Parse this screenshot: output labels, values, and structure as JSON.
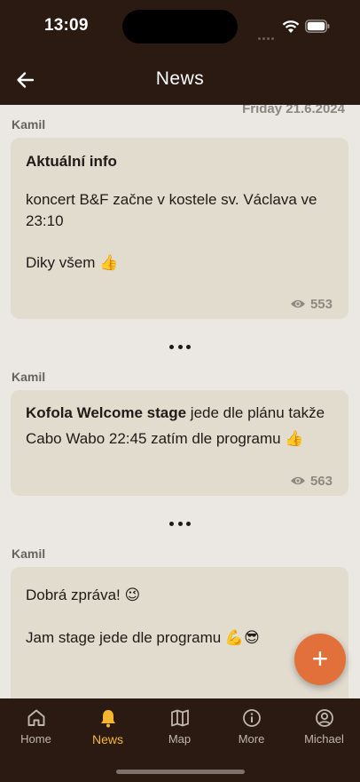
{
  "status": {
    "time": "13:09"
  },
  "header": {
    "title": "News"
  },
  "feed": {
    "date_label": "Friday 21.6.2024",
    "posts": [
      {
        "author": "Kamil",
        "heading": "Aktuální info",
        "body_line1": "koncert B&F začne v kostele sv. Václava ve",
        "body_line2": "23:10",
        "body_line3": "Diky všem 👍",
        "views": "553"
      },
      {
        "author": "Kamil",
        "heading": "Kofola Welcome stage",
        "body_inline": " jede dle plánu takže",
        "body_line2": "Cabo Wabo 22:45 zatím dle programu 👍",
        "views": "563"
      },
      {
        "author": "Kamil",
        "body_line1": "Dobrá zpráva! 😉",
        "body_line2": "Jam stage jede dle programu 💪😎"
      }
    ]
  },
  "fab": {
    "label": "+"
  },
  "tabs": [
    {
      "label": "Home",
      "icon": "home-icon"
    },
    {
      "label": "News",
      "icon": "bell-icon"
    },
    {
      "label": "Map",
      "icon": "map-icon"
    },
    {
      "label": "More",
      "icon": "info-icon"
    },
    {
      "label": "Michael",
      "icon": "user-icon"
    }
  ],
  "colors": {
    "bar": "#2b1a12",
    "accent": "#e2703b",
    "active_tab": "#f5b731",
    "card": "#e2dccf"
  }
}
